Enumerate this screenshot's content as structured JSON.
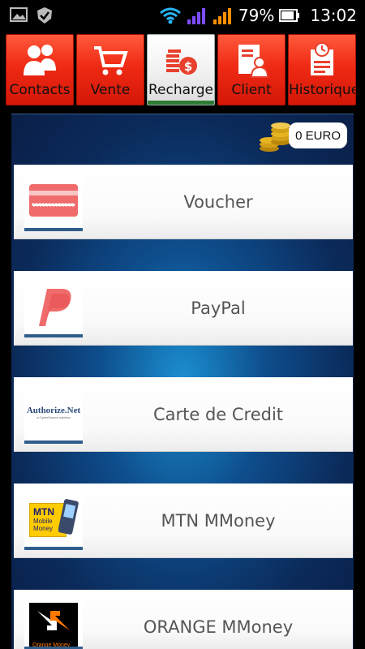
{
  "status_bar": {
    "left_icons": [
      "image-icon",
      "check-badge-icon"
    ],
    "right_icons": [
      "wifi-icon",
      "signal-1-icon",
      "signal-2-icon"
    ],
    "battery_percent": "79%",
    "time": "13:02"
  },
  "tabs": [
    {
      "label": "Contacts",
      "icon": "contacts-icon",
      "selected": false
    },
    {
      "label": "Vente",
      "icon": "cart-icon",
      "selected": false
    },
    {
      "label": "Recharge",
      "icon": "coins-stack-icon",
      "selected": true
    },
    {
      "label": "Client",
      "icon": "client-icon",
      "selected": false
    },
    {
      "label": "Historique",
      "icon": "history-icon",
      "selected": false
    }
  ],
  "balance": {
    "text": "0 EURO",
    "icon": "gold-coins-icon"
  },
  "payment_methods": [
    {
      "label": "Voucher",
      "icon": "voucher-card-icon"
    },
    {
      "label": "PayPal",
      "icon": "paypal-logo"
    },
    {
      "label": "Carte de Credit",
      "icon": "authorize-net-logo",
      "logo_text": "Authorize.Net",
      "logo_subtext": "a CyberSource solution"
    },
    {
      "label": "MTN MMoney",
      "icon": "mtn-mobile-money-logo",
      "logo_text": "MTN",
      "logo_subtext": "Mobile Money"
    },
    {
      "label": "ORANGE MMoney",
      "icon": "orange-money-logo",
      "logo_text": "Orange Money"
    }
  ],
  "colors": {
    "tab_red": "#ef2a14",
    "tab_selected": "#f2f2f2",
    "selected_indicator": "#2e7d32",
    "background_blue": "#0b2a5a",
    "card_text": "#555555"
  }
}
